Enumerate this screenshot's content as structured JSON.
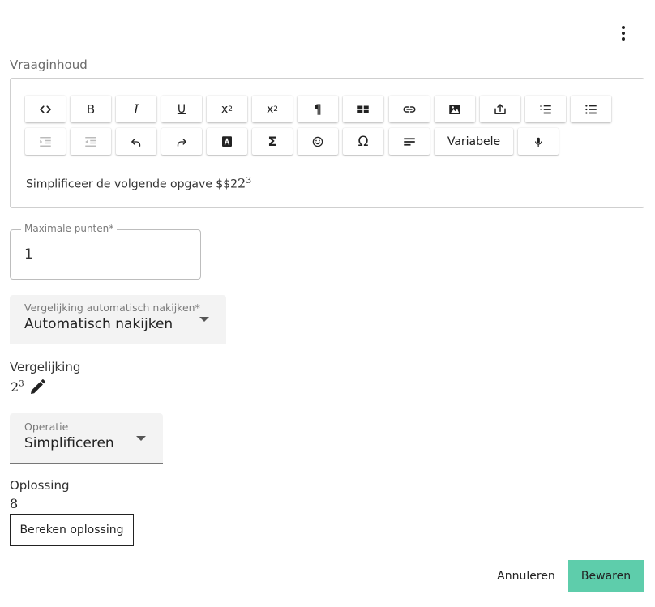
{
  "header": {
    "menu_icon": "more-vertical-icon"
  },
  "editor": {
    "label": "Vraaginhoud",
    "toolbar": {
      "row1": [
        {
          "name": "code-view",
          "icon": "code-icon"
        },
        {
          "name": "bold",
          "text": "B"
        },
        {
          "name": "italic",
          "text": "I"
        },
        {
          "name": "underline",
          "text": "U"
        },
        {
          "name": "subscript",
          "text": "x",
          "sub": "2"
        },
        {
          "name": "superscript",
          "text": "x",
          "sup": "2"
        },
        {
          "name": "paragraph",
          "text": "¶"
        },
        {
          "name": "table",
          "icon": "table-icon"
        },
        {
          "name": "link",
          "icon": "link-icon"
        },
        {
          "name": "image",
          "icon": "image-icon"
        },
        {
          "name": "upload",
          "icon": "upload-icon"
        },
        {
          "name": "ordered-list",
          "icon": "ordered-list-icon"
        },
        {
          "name": "bullet-list",
          "icon": "bullet-list-icon"
        }
      ],
      "row2": [
        {
          "name": "indent",
          "icon": "indent-icon",
          "disabled": true
        },
        {
          "name": "outdent",
          "icon": "outdent-icon",
          "disabled": true
        },
        {
          "name": "undo",
          "icon": "undo-icon"
        },
        {
          "name": "redo",
          "icon": "redo-icon"
        },
        {
          "name": "text-color",
          "icon": "text-color-icon"
        },
        {
          "name": "sigma",
          "text": "Σ"
        },
        {
          "name": "emoji",
          "icon": "emoji-icon"
        },
        {
          "name": "special-char",
          "text": "Ω"
        },
        {
          "name": "align",
          "icon": "align-icon"
        },
        {
          "name": "variabele",
          "text": "Variabele"
        },
        {
          "name": "microphone",
          "icon": "microphone-icon"
        }
      ]
    },
    "content_text": "Simplificeer de volgende opgave $$2",
    "content_math_base": "2",
    "content_math_exp": "3"
  },
  "max_points": {
    "label": "Maximale punten*",
    "value": "1"
  },
  "comparison_mode": {
    "label": "Vergelijking automatisch nakijken*",
    "value": "Automatisch nakijken"
  },
  "comparison": {
    "title": "Vergelijking",
    "math_base": "2",
    "math_exp": "3",
    "edit_icon": "pencil-icon"
  },
  "operation": {
    "label": "Operatie",
    "value": "Simplificeren"
  },
  "solution": {
    "title": "Oplossing",
    "value": "8",
    "button_label": "Bereken oplossing"
  },
  "footer": {
    "cancel_label": "Annuleren",
    "save_label": "Bewaren",
    "save_color": "#5ecdab"
  }
}
